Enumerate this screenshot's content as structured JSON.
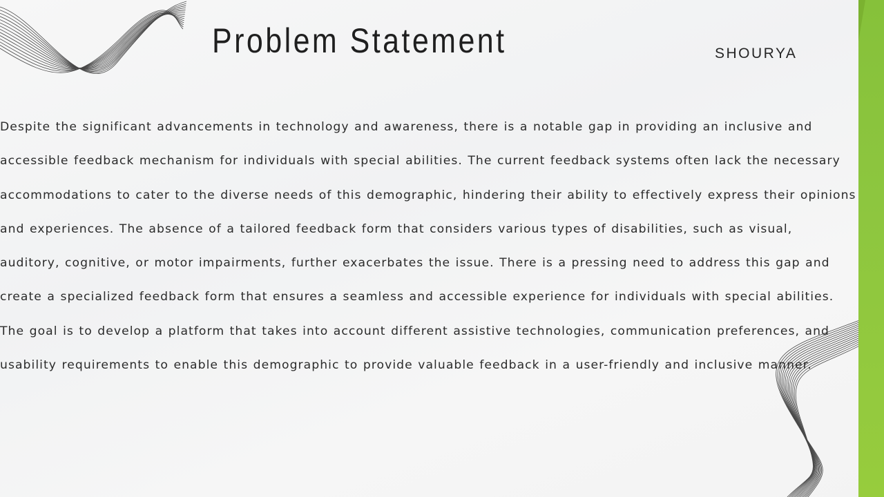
{
  "slide": {
    "title": "Problem Statement",
    "author": "SHOURYA",
    "body": "Despite the significant advancements in technology and awareness, there is a notable gap in providing an inclusive and accessible feedback mechanism for individuals with special abilities. The current feedback systems often lack the necessary accommodations to cater to the diverse needs of this demographic, hindering their ability to effectively express their opinions and experiences. The absence of a tailored feedback form that considers various types of disabilities, such as visual, auditory, cognitive, or motor impairments, further exacerbates the issue. There is a pressing need to address this gap and create a specialized feedback form that ensures a seamless and accessible experience for individuals with special abilities. The goal is to develop a platform that takes into account different assistive technologies, communication preferences, and usability requirements to enable this demographic to provide valuable feedback in a user-friendly and inclusive manner."
  },
  "theme": {
    "accent_color": "#8dc63f",
    "text_color": "#2b2b2b",
    "background_color": "#f4f4f4"
  }
}
